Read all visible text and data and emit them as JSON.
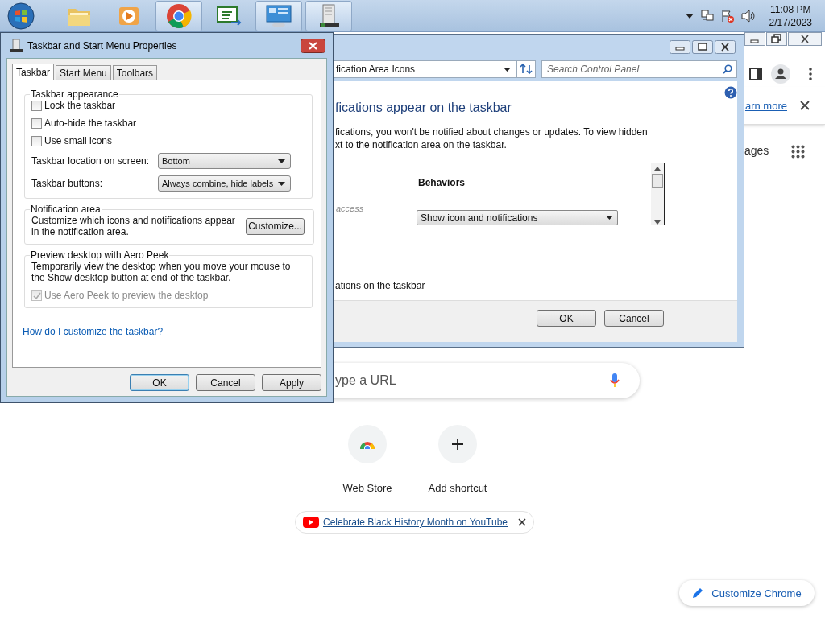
{
  "taskbar": {
    "apps": [
      {
        "kind": "folder",
        "active": false
      },
      {
        "kind": "media",
        "active": false
      },
      {
        "kind": "chrome",
        "active": true
      },
      {
        "kind": "csharp",
        "active": false
      },
      {
        "kind": "control-panel",
        "active": true
      },
      {
        "kind": "properties",
        "active": true
      }
    ],
    "clock": {
      "time": "11:08 PM",
      "date": "2/17/2023"
    }
  },
  "chrome": {
    "banner_link": "arn more",
    "apps_label": "ages",
    "omnibox": {
      "placeholder": "ype a URL"
    },
    "shortcuts": [
      {
        "kind": "webstore",
        "label": "Web Store"
      },
      {
        "kind": "add",
        "label": "Add shortcut"
      }
    ],
    "promo": {
      "link": "Celebrate Black History Month on YouTube"
    },
    "customize_button": "Customize Chrome"
  },
  "control_panel": {
    "address": "fication Area Icons",
    "search": {
      "placeholder": "Search Control Panel"
    },
    "heading": "fications appear on the taskbar",
    "description": [
      "fications, you won't be notified about changes or updates. To view hidden",
      "xt to the notification area on the taskbar."
    ],
    "table": {
      "column_2": "Behaviors",
      "rows": [
        {
          "column_1": "access",
          "behavior": "Show icon and notifications"
        }
      ]
    },
    "checkbox_label": "ations on the taskbar",
    "buttons": [
      "OK",
      "Cancel"
    ]
  },
  "dialog": {
    "title": "Taskbar and Start Menu Properties",
    "tabs": [
      {
        "label": "Taskbar",
        "selected": true
      },
      {
        "label": "Start Menu",
        "selected": false
      },
      {
        "label": "Toolbars",
        "selected": false
      }
    ],
    "appearance": {
      "title": "Taskbar appearance",
      "checkboxes": [
        {
          "label": "Lock the taskbar",
          "checked": false
        },
        {
          "label": "Auto-hide the taskbar",
          "checked": false
        },
        {
          "label": "Use small icons",
          "checked": false
        }
      ],
      "fields": [
        {
          "label": "Taskbar location on screen:",
          "value": "Bottom"
        },
        {
          "label": "Taskbar buttons:",
          "value": "Always combine, hide labels"
        }
      ]
    },
    "notification": {
      "title": "Notification area",
      "text": "Customize which icons and notifications appear in the notification area.",
      "button": "Customize..."
    },
    "aero_peek": {
      "title": "Preview desktop with Aero Peek",
      "text": "Temporarily view the desktop when you move your mouse to the Show desktop button at end of the taskbar.",
      "checkbox": {
        "label": "Use Aero Peek to preview the desktop",
        "checked": true,
        "disabled": true
      }
    },
    "link": "How do I customize the taskbar?",
    "buttons": [
      {
        "label": "OK",
        "default": true
      },
      {
        "label": "Cancel",
        "default": false
      },
      {
        "label": "Apply",
        "default": false
      }
    ]
  }
}
